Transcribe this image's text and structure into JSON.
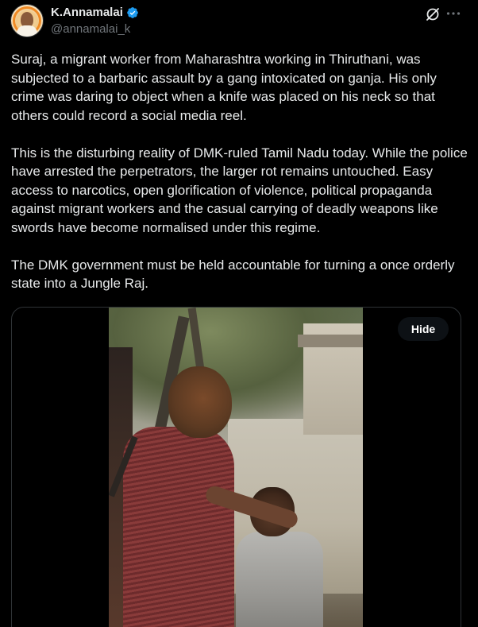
{
  "author": {
    "display_name": "K.Annamalai",
    "handle": "@annamalai_k",
    "verified": true,
    "verified_color": "#1d9bf0"
  },
  "header_icons": [
    "grok-icon",
    "more-icon"
  ],
  "post": {
    "paragraphs": [
      "Suraj, a migrant worker from Maharashtra working in Thiruthani, was subjected to a barbaric assault by a gang intoxicated on ganja. His only crime was daring to object when a knife was placed on his neck so that others could record a social media reel.",
      "This is the disturbing reality of DMK-ruled Tamil Nadu today. While the police have arrested the perpetrators, the larger rot remains untouched. Easy access to narcotics, open glorification of violence, political propaganda against migrant workers and the casual carrying of deadly weapons like swords have become normalised under this regime.",
      "The DMK government must be held accountable for turning a once orderly state into a Jungle Raj."
    ]
  },
  "media": {
    "hide_label": "Hide"
  },
  "colors": {
    "background": "#000000",
    "text_primary": "#e7e9ea",
    "text_secondary": "#71767b",
    "border": "#2f3336"
  }
}
